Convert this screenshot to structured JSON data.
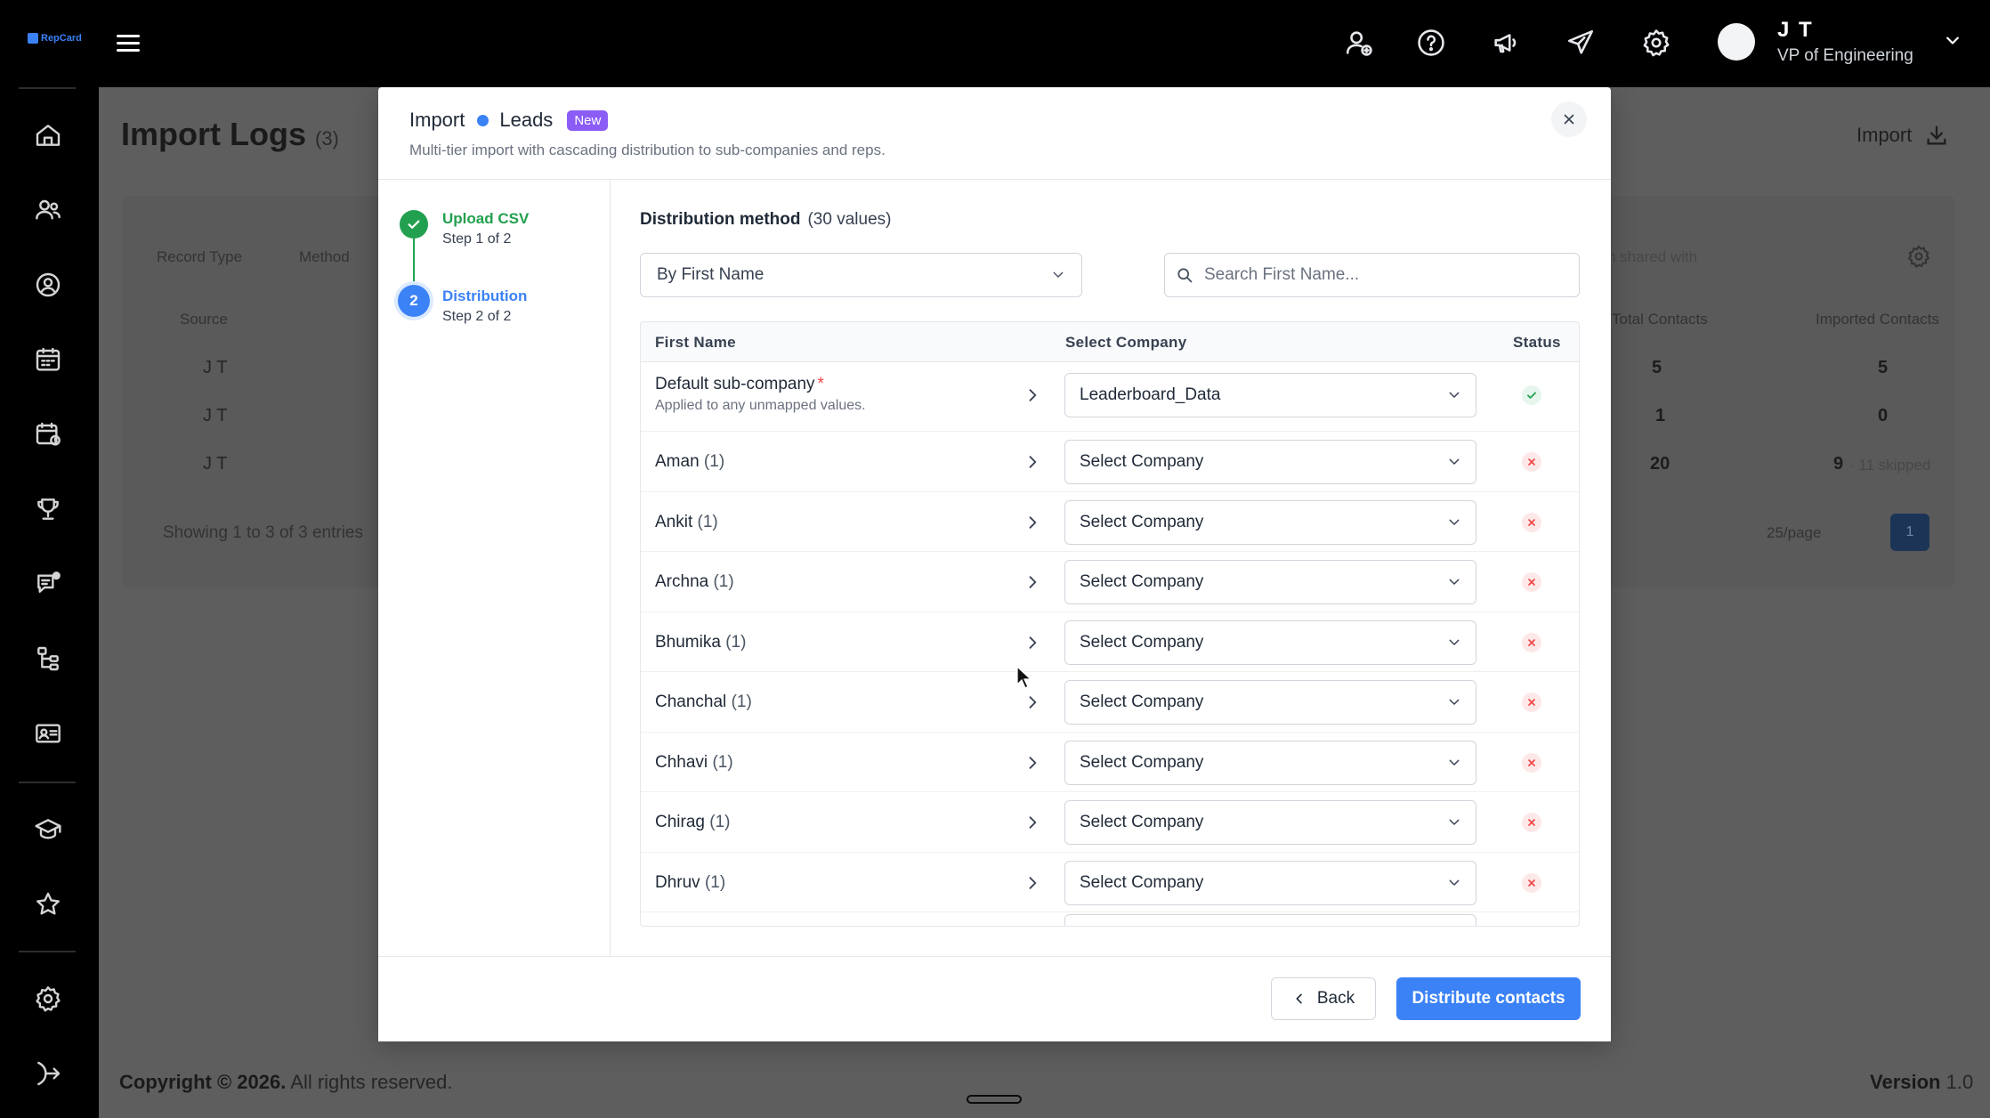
{
  "topbar": {
    "logo_text": "RepCard",
    "user": {
      "name": "J T",
      "role": "VP of Engineering"
    },
    "icons": [
      "user-add-icon",
      "help-icon",
      "megaphone-icon",
      "send-icon",
      "settings-icon"
    ]
  },
  "sidebar": {
    "icons": [
      "home-icon",
      "users-icon",
      "contacts-icon",
      "calendar-icon",
      "schedule-icon",
      "trophy-icon",
      "chat-icon",
      "hierarchy-icon",
      "id-card-icon",
      "graduation-icon",
      "star-icon",
      "settings-icon",
      "logout-icon"
    ]
  },
  "background": {
    "title": "Import Logs",
    "title_count": "(3)",
    "import_button": "Import",
    "filters": [
      "Record Type",
      "Method"
    ],
    "search_placeholder": "n shared with",
    "columns": [
      "Source",
      "Total Contacts",
      "Imported Contacts"
    ],
    "rows": [
      {
        "source": "J T",
        "total": "5",
        "imported": "5",
        "note": ""
      },
      {
        "source": "J T",
        "total": "1",
        "imported": "0",
        "note": ""
      },
      {
        "source": "J T",
        "total": "20",
        "imported": "9",
        "note": "· 11 skipped"
      }
    ],
    "showing": "Showing 1 to 3 of 3 entries",
    "page_size": "25/page",
    "current_page": "1",
    "footer_copyright": "Copyright © 2026.",
    "footer_rights": "All rights reserved.",
    "footer_version_label": "Version",
    "footer_version": "1.0"
  },
  "modal": {
    "title_import": "Import",
    "title_entity": "Leads",
    "badge": "New",
    "subtitle": "Multi-tier import with cascading distribution to sub-companies and reps.",
    "steps": [
      {
        "label": "Upload CSV",
        "meta": "Step 1 of 2",
        "state": "done"
      },
      {
        "label": "Distribution",
        "meta": "Step 2 of 2",
        "number": "2",
        "state": "current"
      }
    ],
    "distribution_label": "Distribution method",
    "distribution_count": "(30 values)",
    "method_value": "By First Name",
    "search_placeholder": "Search First Name...",
    "columns": {
      "first_name": "First Name",
      "select_company": "Select Company",
      "status": "Status"
    },
    "default_row": {
      "name": "Default sub-company",
      "required_mark": "*",
      "hint": "Applied to any unmapped values.",
      "company": "Leaderboard_Data",
      "status": "mapped"
    },
    "rows": [
      {
        "name": "Aman",
        "count": "(1)",
        "company": "Select Company",
        "status": "unmapped"
      },
      {
        "name": "Ankit",
        "count": "(1)",
        "company": "Select Company",
        "status": "unmapped"
      },
      {
        "name": "Archna",
        "count": "(1)",
        "company": "Select Company",
        "status": "unmapped"
      },
      {
        "name": "Bhumika",
        "count": "(1)",
        "company": "Select Company",
        "status": "unmapped"
      },
      {
        "name": "Chanchal",
        "count": "(1)",
        "company": "Select Company",
        "status": "unmapped"
      },
      {
        "name": "Chhavi",
        "count": "(1)",
        "company": "Select Company",
        "status": "unmapped"
      },
      {
        "name": "Chirag",
        "count": "(1)",
        "company": "Select Company",
        "status": "unmapped"
      },
      {
        "name": "Dhruv",
        "count": "(1)",
        "company": "Select Company",
        "status": "unmapped"
      }
    ],
    "back_button": "Back",
    "primary_button": "Distribute contacts"
  },
  "colors": {
    "accent": "#3b82f6",
    "success": "#22a04f",
    "error": "#ef4444",
    "badge": "#8b5cf6"
  }
}
